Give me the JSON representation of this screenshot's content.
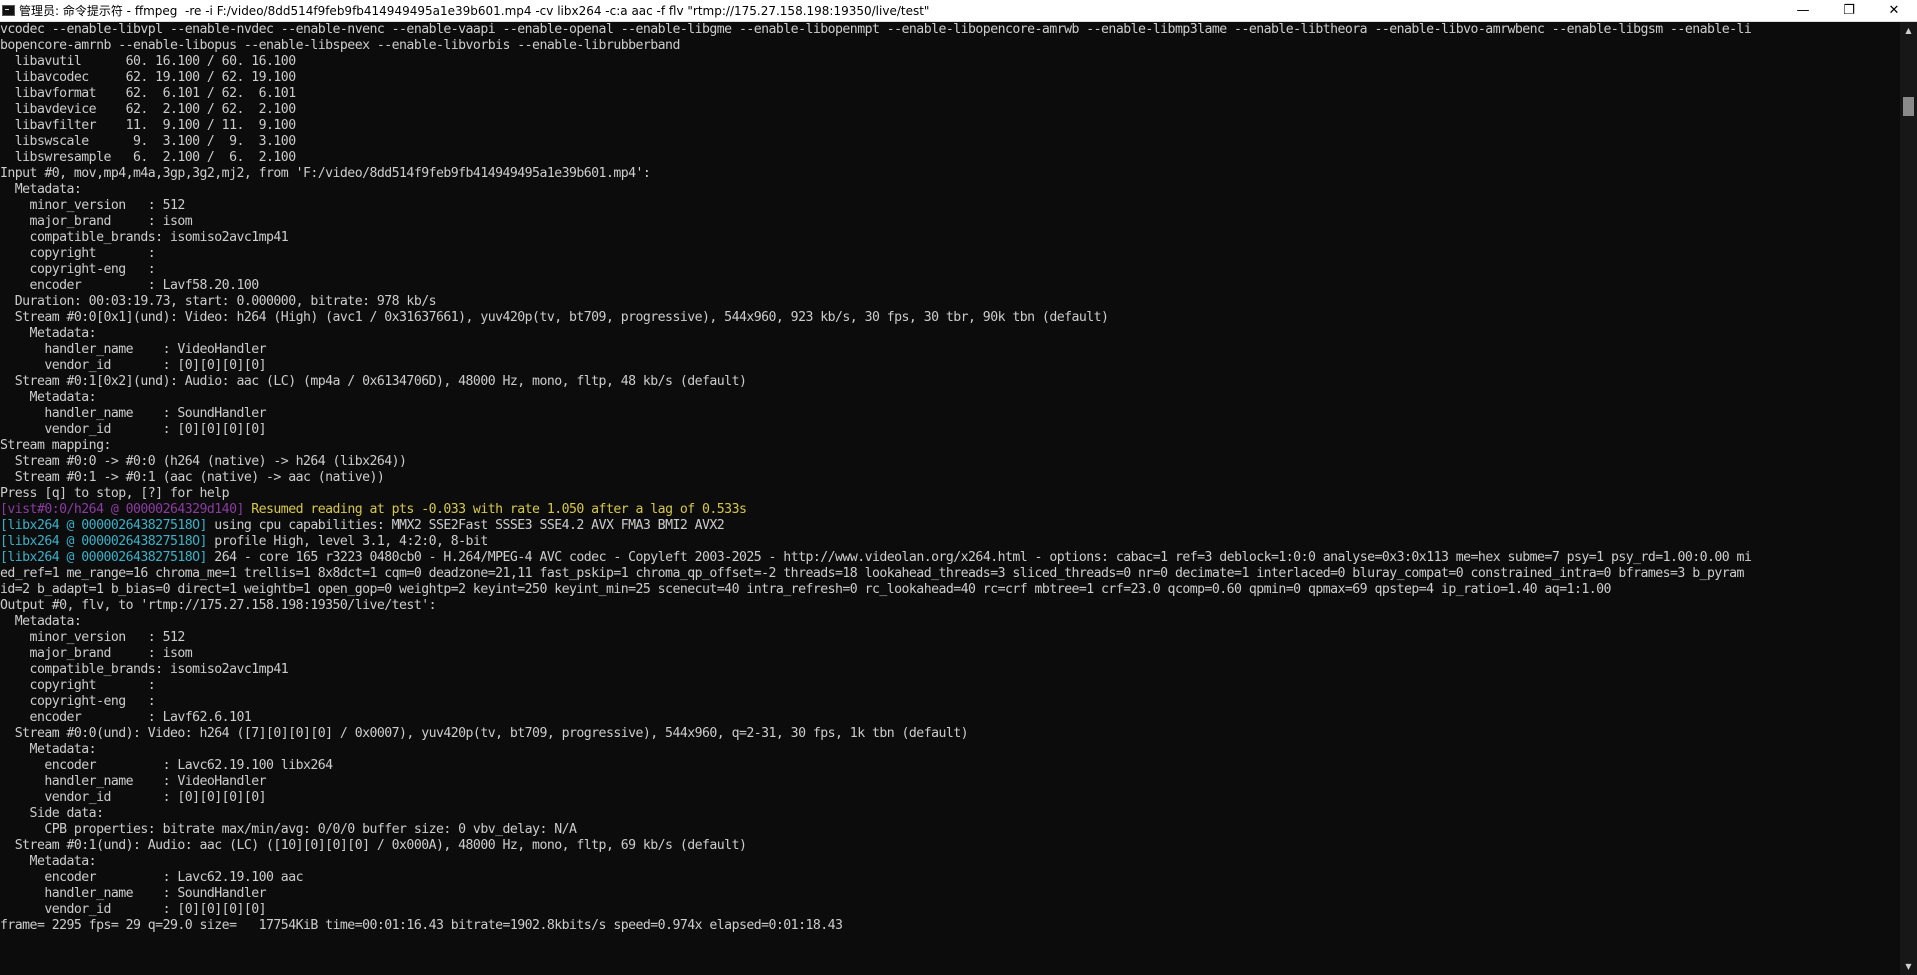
{
  "window": {
    "title": "管理员: 命令提示符 - ffmpeg  -re -i F:/video/8dd514f9feb9fb414949495a1e39b601.mp4 -cv libx264 -c:a aac -f flv \"rtmp://175.27.158.198:19350/live/test\"",
    "controls": {
      "minimize": "—",
      "maximize": "❐",
      "close": "✕"
    },
    "icon": "terminal-icon"
  },
  "console": {
    "lines": [
      "vcodec --enable-libvpl --enable-nvdec --enable-nvenc --enable-vaapi --enable-openal --enable-libgme --enable-libopenmpt --enable-libopencore-amrwb --enable-libmp3lame --enable-libtheora --enable-libvo-amrwbenc --enable-libgsm --enable-li",
      "bopencore-amrnb --enable-libopus --enable-libspeex --enable-libvorbis --enable-librubberband",
      "  libavutil      60. 16.100 / 60. 16.100",
      "  libavcodec     62. 19.100 / 62. 19.100",
      "  libavformat    62.  6.101 / 62.  6.101",
      "  libavdevice    62.  2.100 / 62.  2.100",
      "  libavfilter    11.  9.100 / 11.  9.100",
      "  libswscale      9.  3.100 /  9.  3.100",
      "  libswresample   6.  2.100 /  6.  2.100",
      "Input #0, mov,mp4,m4a,3gp,3g2,mj2, from 'F:/video/8dd514f9feb9fb414949495a1e39b601.mp4':",
      "  Metadata:",
      "    minor_version   : 512",
      "    major_brand     : isom",
      "    compatible_brands: isomiso2avc1mp41",
      "    copyright       :",
      "    copyright-eng   :",
      "    encoder         : Lavf58.20.100",
      "  Duration: 00:03:19.73, start: 0.000000, bitrate: 978 kb/s",
      "  Stream #0:0[0x1](und): Video: h264 (High) (avc1 / 0x31637661), yuv420p(tv, bt709, progressive), 544x960, 923 kb/s, 30 fps, 30 tbr, 90k tbn (default)",
      "    Metadata:",
      "      handler_name    : VideoHandler",
      "      vendor_id       : [0][0][0][0]",
      "  Stream #0:1[0x2](und): Audio: aac (LC) (mp4a / 0x6134706D), 48000 Hz, mono, fltp, 48 kb/s (default)",
      "    Metadata:",
      "      handler_name    : SoundHandler",
      "      vendor_id       : [0][0][0][0]",
      "Stream mapping:",
      "  Stream #0:0 -> #0:0 (h264 (native) -> h264 (libx264))",
      "  Stream #0:1 -> #0:1 (aac (native) -> aac (native))",
      "Press [q] to stop, [?] for help",
      "",
      "",
      "",
      "",
      "ed_ref=1 me_range=16 chroma_me=1 trellis=1 8x8dct=1 cqm=0 deadzone=21,11 fast_pskip=1 chroma_qp_offset=-2 threads=18 lookahead_threads=3 sliced_threads=0 nr=0 decimate=1 interlaced=0 bluray_compat=0 constrained_intra=0 bframes=3 b_pyram",
      "id=2 b_adapt=1 b_bias=0 direct=1 weightb=1 open_gop=0 weightp=2 keyint=250 keyint_min=25 scenecut=40 intra_refresh=0 rc_lookahead=40 rc=crf mbtree=1 crf=23.0 qcomp=0.60 qpmin=0 qpmax=69 qpstep=4 ip_ratio=1.40 aq=1:1.00",
      "Output #0, flv, to 'rtmp://175.27.158.198:19350/live/test':",
      "  Metadata:",
      "    minor_version   : 512",
      "    major_brand     : isom",
      "    compatible_brands: isomiso2avc1mp41",
      "    copyright       :",
      "    copyright-eng   :",
      "    encoder         : Lavf62.6.101",
      "  Stream #0:0(und): Video: h264 ([7][0][0][0] / 0x0007), yuv420p(tv, bt709, progressive), 544x960, q=2-31, 30 fps, 1k tbn (default)",
      "    Metadata:",
      "      encoder         : Lavc62.19.100 libx264",
      "      handler_name    : VideoHandler",
      "      vendor_id       : [0][0][0][0]",
      "    Side data:",
      "      CPB properties: bitrate max/min/avg: 0/0/0 buffer size: 0 vbv_delay: N/A",
      "  Stream #0:1(und): Audio: aac (LC) ([10][0][0][0] / 0x000A), 48000 Hz, mono, fltp, 69 kb/s (default)",
      "    Metadata:",
      "      encoder         : Lavc62.19.100 aac",
      "      handler_name    : SoundHandler",
      "      vendor_id       : [0][0][0][0]",
      "frame= 2295 fps= 29 q=29.0 size=   17754KiB time=00:01:16.43 bitrate=1902.8kbits/s speed=0.974x elapsed=0:01:18.43"
    ],
    "colored_lines": {
      "vist": {
        "prefix": "[vist#0:0/h264 @ 00000264329d140]",
        "text": " Resumed reading at pts -0.033 with rate 1.050 after a lag of 0.533s"
      },
      "libx264_1": {
        "prefix": "[libx264 @ 000002643827518O]",
        "text": " using cpu capabilities: MMX2 SSE2Fast SSSE3 SSE4.2 AVX FMA3 BMI2 AVX2"
      },
      "libx264_2": {
        "prefix": "[libx264 @ 000002643827518O]",
        "text": " profile High, level 3.1, 4:2:0, 8-bit"
      },
      "libx264_3": {
        "prefix": "[libx264 @ 000002643827518O]",
        "text": " 264 - core 165 r3223 0480cb0 - H.264/MPEG-4 AVC codec - Copyleft 2003-2025 - http://www.videolan.org/x264.html - options: cabac=1 ref=3 deblock=1:0:0 analyse=0x3:0x113 me=hex subme=7 psy=1 psy_rd=1.00:0.00 mi"
      }
    }
  },
  "colors": {
    "background": "#0c0c0c",
    "text": "#cccccc",
    "context_cyan": "#3ab0c8",
    "context_purple": "#8a3ca0",
    "warning_yellow": "#d7c84a"
  },
  "scrollbar": {
    "up_arrow": "▲",
    "down_arrow": "▼"
  }
}
